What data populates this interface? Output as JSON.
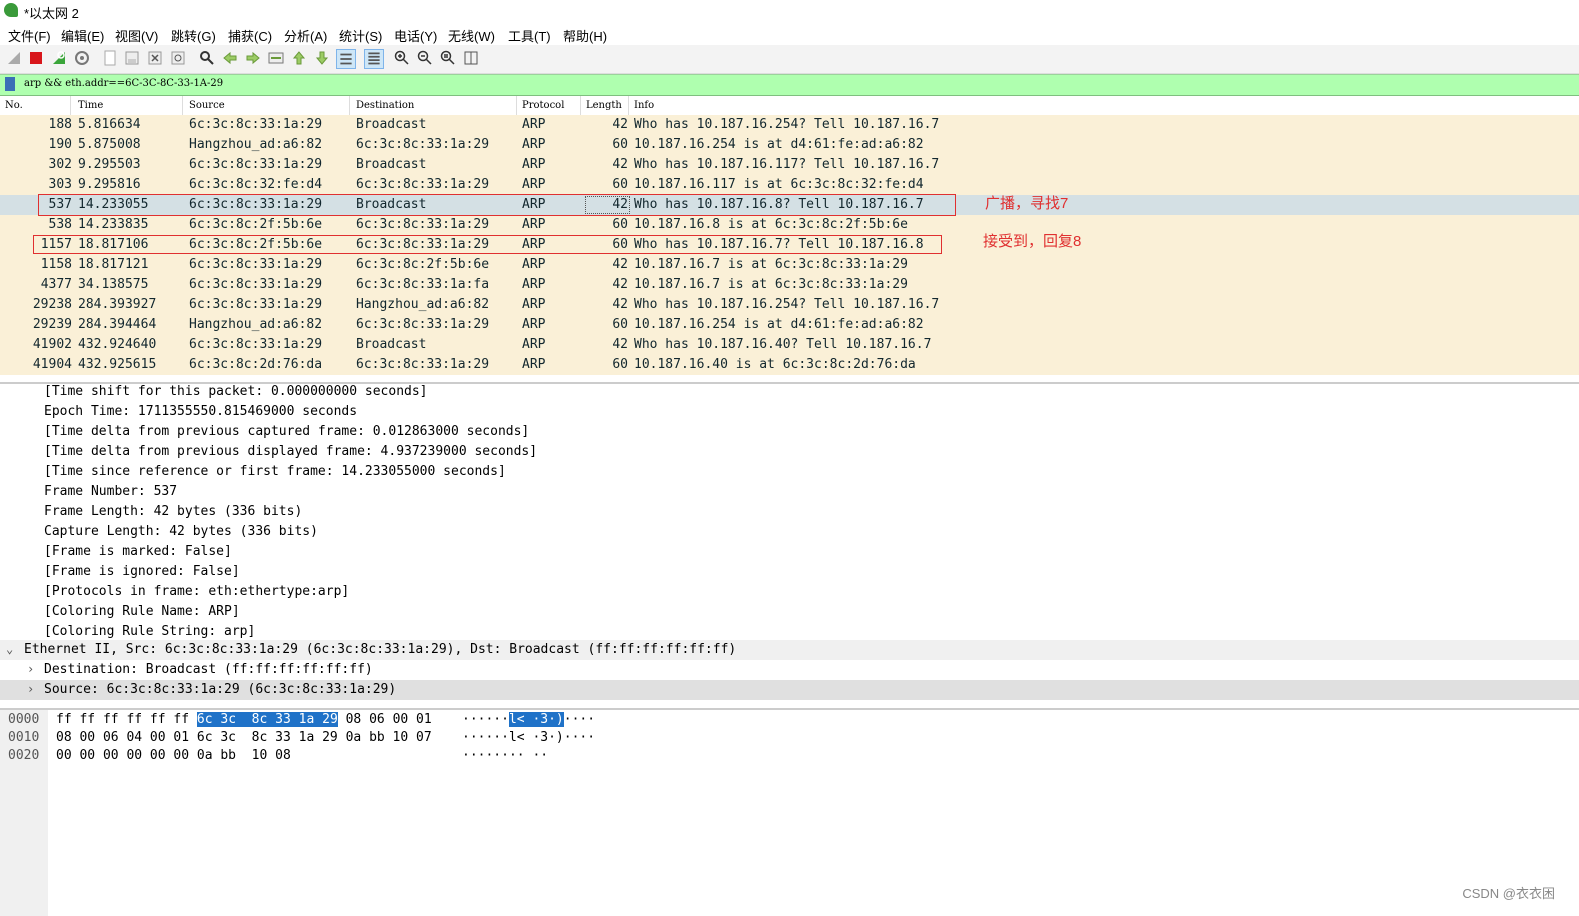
{
  "window": {
    "title": "*以太网 2"
  },
  "menu": [
    "文件(F)",
    "编辑(E)",
    "视图(V)",
    "跳转(G)",
    "捕获(C)",
    "分析(A)",
    "统计(S)",
    "电话(Y)",
    "无线(W)",
    "工具(T)",
    "帮助(H)"
  ],
  "filter": {
    "text": "arp && eth.addr==6C-3C-8C-33-1A-29"
  },
  "columns": [
    "No.",
    "Time",
    "Source",
    "Destination",
    "Protocol",
    "Length",
    "Info"
  ],
  "packets": [
    {
      "no": "188",
      "time": "5.816634",
      "src": "6c:3c:8c:33:1a:29",
      "dst": "Broadcast",
      "proto": "ARP",
      "len": "42",
      "info": "Who has 10.187.16.254? Tell 10.187.16.7"
    },
    {
      "no": "190",
      "time": "5.875008",
      "src": "Hangzhou_ad:a6:82",
      "dst": "6c:3c:8c:33:1a:29",
      "proto": "ARP",
      "len": "60",
      "info": "10.187.16.254 is at d4:61:fe:ad:a6:82"
    },
    {
      "no": "302",
      "time": "9.295503",
      "src": "6c:3c:8c:33:1a:29",
      "dst": "Broadcast",
      "proto": "ARP",
      "len": "42",
      "info": "Who has 10.187.16.117? Tell 10.187.16.7"
    },
    {
      "no": "303",
      "time": "9.295816",
      "src": "6c:3c:8c:32:fe:d4",
      "dst": "6c:3c:8c:33:1a:29",
      "proto": "ARP",
      "len": "60",
      "info": "10.187.16.117 is at 6c:3c:8c:32:fe:d4"
    },
    {
      "no": "537",
      "time": "14.233055",
      "src": "6c:3c:8c:33:1a:29",
      "dst": "Broadcast",
      "proto": "ARP",
      "len": "42",
      "info": "Who has 10.187.16.8? Tell 10.187.16.7"
    },
    {
      "no": "538",
      "time": "14.233835",
      "src": "6c:3c:8c:2f:5b:6e",
      "dst": "6c:3c:8c:33:1a:29",
      "proto": "ARP",
      "len": "60",
      "info": "10.187.16.8 is at 6c:3c:8c:2f:5b:6e"
    },
    {
      "no": "1157",
      "time": "18.817106",
      "src": "6c:3c:8c:2f:5b:6e",
      "dst": "6c:3c:8c:33:1a:29",
      "proto": "ARP",
      "len": "60",
      "info": "Who has 10.187.16.7? Tell 10.187.16.8"
    },
    {
      "no": "1158",
      "time": "18.817121",
      "src": "6c:3c:8c:33:1a:29",
      "dst": "6c:3c:8c:2f:5b:6e",
      "proto": "ARP",
      "len": "42",
      "info": "10.187.16.7 is at 6c:3c:8c:33:1a:29"
    },
    {
      "no": "4377",
      "time": "34.138575",
      "src": "6c:3c:8c:33:1a:29",
      "dst": "6c:3c:8c:33:1a:fa",
      "proto": "ARP",
      "len": "42",
      "info": "10.187.16.7 is at 6c:3c:8c:33:1a:29"
    },
    {
      "no": "29238",
      "time": "284.393927",
      "src": "6c:3c:8c:33:1a:29",
      "dst": "Hangzhou_ad:a6:82",
      "proto": "ARP",
      "len": "42",
      "info": "Who has 10.187.16.254? Tell 10.187.16.7"
    },
    {
      "no": "29239",
      "time": "284.394464",
      "src": "Hangzhou_ad:a6:82",
      "dst": "6c:3c:8c:33:1a:29",
      "proto": "ARP",
      "len": "60",
      "info": "10.187.16.254 is at d4:61:fe:ad:a6:82"
    },
    {
      "no": "41902",
      "time": "432.924640",
      "src": "6c:3c:8c:33:1a:29",
      "dst": "Broadcast",
      "proto": "ARP",
      "len": "42",
      "info": "Who has 10.187.16.40? Tell 10.187.16.7"
    },
    {
      "no": "41904",
      "time": "432.925615",
      "src": "6c:3c:8c:2d:76:da",
      "dst": "6c:3c:8c:33:1a:29",
      "proto": "ARP",
      "len": "60",
      "info": "10.187.16.40 is at 6c:3c:8c:2d:76:da"
    }
  ],
  "annotations": {
    "a1": "广播，寻找7",
    "a2": "接受到，回复8"
  },
  "details": [
    "[Time shift for this packet: 0.000000000 seconds]",
    "Epoch Time: 1711355550.815469000 seconds",
    "[Time delta from previous captured frame: 0.012863000 seconds]",
    "[Time delta from previous displayed frame: 4.937239000 seconds]",
    "[Time since reference or first frame: 14.233055000 seconds]",
    "Frame Number: 537",
    "Frame Length: 42 bytes (336 bits)",
    "Capture Length: 42 bytes (336 bits)",
    "[Frame is marked: False]",
    "[Frame is ignored: False]",
    "[Protocols in frame: eth:ethertype:arp]",
    "[Coloring Rule Name: ARP]",
    "[Coloring Rule String: arp]"
  ],
  "ethernet": {
    "header": "Ethernet II, Src: 6c:3c:8c:33:1a:29 (6c:3c:8c:33:1a:29), Dst: Broadcast (ff:ff:ff:ff:ff:ff)",
    "dst": "Destination: Broadcast (ff:ff:ff:ff:ff:ff)",
    "src": "Source: 6c:3c:8c:33:1a:29 (6c:3c:8c:33:1a:29)"
  },
  "bytes": [
    {
      "off": "0000",
      "hex_pre": "ff ff ff ff ff ff ",
      "hex_hl": "6c 3c  8c 33 1a 29",
      "hex_post": " 08 06 00 01",
      "asc_pre": "······",
      "asc_hl": "l< ·3·)",
      "asc_post": "····"
    },
    {
      "off": "0010",
      "hex_pre": "08 00 06 04 00 01 6c 3c  8c 33 1a 29 0a bb 10 07",
      "hex_hl": "",
      "hex_post": "",
      "asc_pre": "······l< ·3·)····",
      "asc_hl": "",
      "asc_post": ""
    },
    {
      "off": "0020",
      "hex_pre": "00 00 00 00 00 00 0a bb  10 08",
      "hex_hl": "",
      "hex_post": "",
      "asc_pre": "········ ··",
      "asc_hl": "",
      "asc_post": ""
    }
  ],
  "watermark": "CSDN @衣衣困"
}
